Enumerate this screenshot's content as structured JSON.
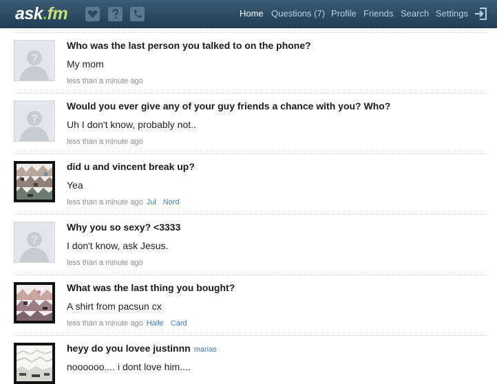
{
  "brand": {
    "name": "ask",
    "dot": ".",
    "tld": "fm"
  },
  "nav": [
    {
      "label": "Home",
      "active": true
    },
    {
      "label": "Questions (7)",
      "active": false
    },
    {
      "label": "Profile",
      "active": false
    },
    {
      "label": "Friends",
      "active": false
    },
    {
      "label": "Search",
      "active": false
    },
    {
      "label": "Settings",
      "active": false
    }
  ],
  "icons": {
    "top": [
      "heart-icon",
      "question-icon",
      "phone-icon"
    ],
    "logout": "logout-icon"
  },
  "feed": [
    {
      "question": "Who was the last person you talked to on the phone?",
      "answer": "My mom",
      "time": "less than a minute ago",
      "avatar": "default"
    },
    {
      "question": "Would you ever give any of your guy friends a chance with you? Who?",
      "answer": "Uh I don't know, probably not..",
      "time": "less than a minute ago",
      "avatar": "default"
    },
    {
      "question": "did u and vincent break up?",
      "answer": "Yea",
      "time": "less than a minute ago",
      "avatar": "photo",
      "links": [
        "Jul",
        "Nord"
      ]
    },
    {
      "question": "Why you so sexy? <3333",
      "answer": "I don't know, ask Jesus.",
      "time": "less than a minute ago",
      "avatar": "default"
    },
    {
      "question": "What was the last thing you bought?",
      "answer": "A shirt from pacsun cx",
      "time": "less than a minute ago",
      "avatar": "photo",
      "links": [
        "Haile",
        "Card"
      ]
    },
    {
      "question": "heyy do you lovee justinnn",
      "asker": "marias",
      "answer": "noooooo.... i dont love him....",
      "avatar": "photo"
    }
  ]
}
